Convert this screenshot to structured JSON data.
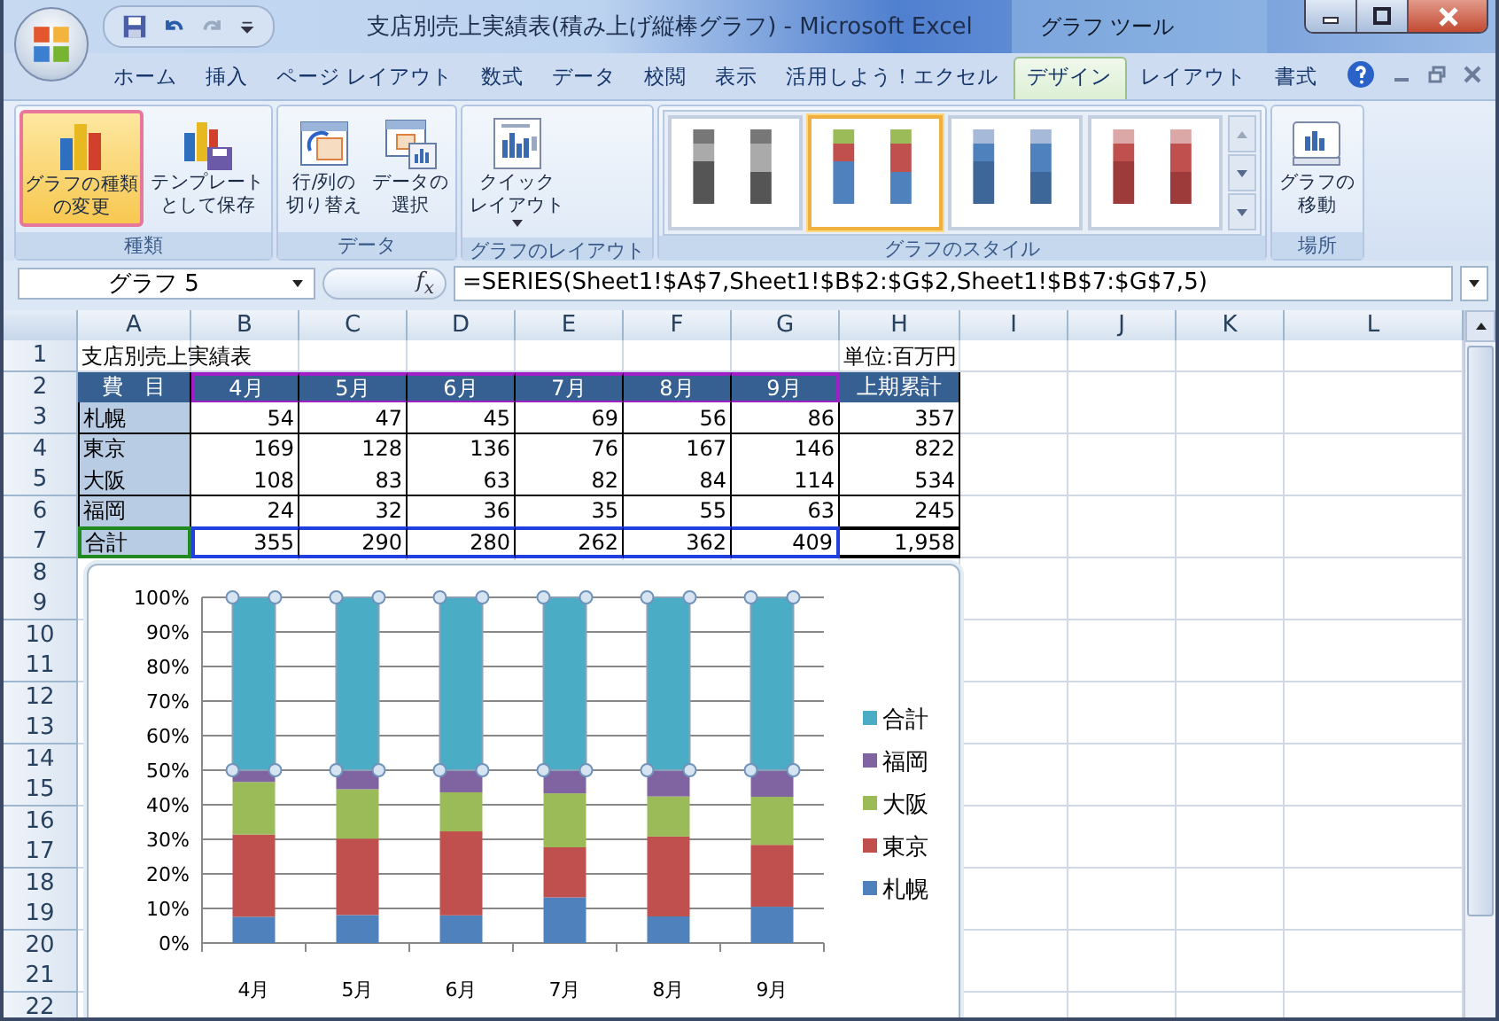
{
  "window": {
    "title": "支店別売上実績表(積み上げ縦棒グラフ) - Microsoft Excel",
    "context_group": "グラフ ツール"
  },
  "tabs": [
    {
      "label": "ホーム",
      "selected": false
    },
    {
      "label": "挿入",
      "selected": false
    },
    {
      "label": "ページ レイアウト",
      "selected": false
    },
    {
      "label": "数式",
      "selected": false
    },
    {
      "label": "データ",
      "selected": false
    },
    {
      "label": "校閲",
      "selected": false
    },
    {
      "label": "表示",
      "selected": false
    },
    {
      "label": "活用しよう！エクセル",
      "selected": false
    },
    {
      "label": "デザイン",
      "selected": true
    },
    {
      "label": "レイアウト",
      "selected": false
    },
    {
      "label": "書式",
      "selected": false
    }
  ],
  "ribbon": {
    "groups": [
      {
        "label": "種類",
        "buttons": [
          {
            "kind": "chart-type",
            "label": [
              "グラフの種類",
              "の変更"
            ],
            "selected": true
          },
          {
            "kind": "template",
            "label": [
              "テンプレート",
              "として保存"
            ],
            "selected": false
          }
        ]
      },
      {
        "label": "データ",
        "buttons": [
          {
            "kind": "switch",
            "label": [
              "行/列の",
              "切り替え"
            ],
            "selected": false
          },
          {
            "kind": "select-data",
            "label": [
              "データの",
              "選択"
            ],
            "selected": false
          }
        ]
      },
      {
        "label": "グラフのレイアウト",
        "buttons": [
          {
            "kind": "quick-layout",
            "label": [
              "クイック",
              "レイアウト"
            ],
            "selected": false,
            "dropdown": true
          }
        ]
      },
      {
        "label": "グラフのスタイル",
        "styles": [
          {
            "kind": "gray",
            "selected": false
          },
          {
            "kind": "colorful",
            "selected": true
          },
          {
            "kind": "blue",
            "selected": false
          },
          {
            "kind": "red",
            "selected": false
          }
        ]
      },
      {
        "label": "場所",
        "buttons": [
          {
            "kind": "move",
            "label": [
              "グラフの",
              "移動"
            ],
            "selected": false
          }
        ]
      }
    ]
  },
  "formula_bar": {
    "name_box": "グラフ 5",
    "fx_label": "f$_{x}$",
    "formula": "=SERIES(Sheet1!$A$7,Sheet1!$B$2:$G$2,Sheet1!$B$7:$G$7,5)"
  },
  "sheet": {
    "columns": [
      "A",
      "B",
      "C",
      "D",
      "E",
      "F",
      "G",
      "H",
      "I",
      "J",
      "K",
      "L"
    ],
    "row_numbers": [
      "1",
      "2",
      "3",
      "4",
      "5",
      "6",
      "7",
      "8",
      "9",
      "10",
      "11",
      "12",
      "13",
      "14",
      "15",
      "16",
      "17",
      "18",
      "19",
      "20",
      "21",
      "22"
    ],
    "title": "支店別売上実績表",
    "unit": "単位:百万円",
    "header": {
      "label": "費　目",
      "months": [
        "4月",
        "5月",
        "6月",
        "7月",
        "8月",
        "9月"
      ],
      "total": "上期累計",
      "range_selected": true
    },
    "rows": [
      {
        "label": "札幌",
        "values": [
          "54",
          "47",
          "45",
          "69",
          "56",
          "86"
        ],
        "total": "357",
        "range_selected": false
      },
      {
        "label": "東京",
        "values": [
          "169",
          "128",
          "136",
          "76",
          "167",
          "146"
        ],
        "total": "822",
        "range_selected": false
      },
      {
        "label": "大阪",
        "values": [
          "108",
          "83",
          "63",
          "82",
          "84",
          "114"
        ],
        "total": "534",
        "range_selected": false
      },
      {
        "label": "福岡",
        "values": [
          "24",
          "32",
          "36",
          "35",
          "55",
          "63"
        ],
        "total": "245",
        "range_selected": false
      },
      {
        "label": "合計",
        "values": [
          "355",
          "290",
          "280",
          "262",
          "362",
          "409"
        ],
        "total": "1,958",
        "range_selected": true
      }
    ]
  },
  "chart": {
    "series_selected": [
      false,
      false,
      false,
      false,
      true
    ],
    "chart_data": {
      "type": "bar",
      "stacked": true,
      "grid": true,
      "legend": "right",
      "categories": [
        "4月",
        "5月",
        "6月",
        "7月",
        "8月",
        "9月"
      ],
      "series": [
        {
          "name": "札幌",
          "color": "#4f81bd",
          "values": [
            7.6,
            8.1,
            8.0,
            13.2,
            7.7,
            10.5
          ]
        },
        {
          "name": "東京",
          "color": "#c0504d",
          "values": [
            23.8,
            22.1,
            24.3,
            14.5,
            23.1,
            17.9
          ]
        },
        {
          "name": "大阪",
          "color": "#9bbb59",
          "values": [
            15.2,
            14.3,
            11.3,
            15.6,
            11.6,
            13.9
          ]
        },
        {
          "name": "福岡",
          "color": "#8064a2",
          "values": [
            3.4,
            5.5,
            6.4,
            6.7,
            7.6,
            7.7
          ]
        },
        {
          "name": "合計",
          "color": "#4bacc6",
          "values": [
            50.0,
            50.0,
            50.0,
            50.0,
            50.0,
            50.0
          ]
        }
      ],
      "ylim": [
        0,
        100
      ],
      "yticks": [
        {
          "value": 0,
          "label": "0%"
        },
        {
          "value": 10,
          "label": "10%"
        },
        {
          "value": 20,
          "label": "20%"
        },
        {
          "value": 30,
          "label": "30%"
        },
        {
          "value": 40,
          "label": "40%"
        },
        {
          "value": 50,
          "label": "50%"
        },
        {
          "value": 60,
          "label": "60%"
        },
        {
          "value": 70,
          "label": "70%"
        },
        {
          "value": 80,
          "label": "80%"
        },
        {
          "value": 90,
          "label": "90%"
        },
        {
          "value": 100,
          "label": "100%"
        }
      ]
    }
  }
}
